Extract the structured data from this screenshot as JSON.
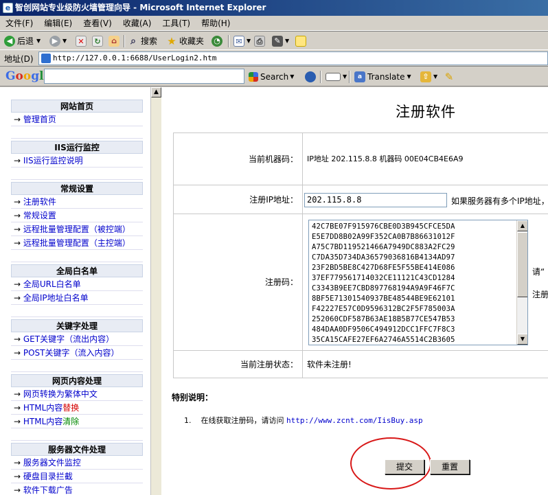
{
  "window": {
    "title": "智创网站专业级防火墙管理向导 - Microsoft Internet Explorer"
  },
  "menu": [
    "文件(F)",
    "编辑(E)",
    "查看(V)",
    "收藏(A)",
    "工具(T)",
    "帮助(H)"
  ],
  "toolbar": {
    "back": "后退",
    "search": "搜索",
    "favorites": "收藏夹"
  },
  "address": {
    "label": "地址(D)",
    "url": "http://127.0.0.1:6688/UserLogin2.htm"
  },
  "google": {
    "logo": "Google",
    "search": "Search",
    "translate": "Translate"
  },
  "nav": [
    {
      "title": "网站首页",
      "items": [
        {
          "text": "管理首页"
        }
      ]
    },
    {
      "title": "IIS运行监控",
      "items": [
        {
          "text": "IIS运行监控说明"
        }
      ]
    },
    {
      "title": "常规设置",
      "items": [
        {
          "text": "注册软件"
        },
        {
          "text": "常规设置"
        },
        {
          "text": "远程批量管理配置（被控端）"
        },
        {
          "text": "远程批量管理配置（主控端）"
        }
      ]
    },
    {
      "title": "全局白名单",
      "items": [
        {
          "text": "全局URL白名单"
        },
        {
          "text": "全局IP地址白名单"
        }
      ]
    },
    {
      "title": "关键字处理",
      "items": [
        {
          "text": "GET关键字（流出内容）"
        },
        {
          "text": "POST关键字（流入内容）"
        }
      ]
    },
    {
      "title": "网页内容处理",
      "items": [
        {
          "text": "网页转换为繁体中文"
        },
        {
          "text": "HTML内容替换"
        },
        {
          "text": "HTML内容清除"
        }
      ]
    },
    {
      "title": "服务器文件处理",
      "items": [
        {
          "text": "服务器文件监控"
        },
        {
          "text": "硬盘目录拦截"
        },
        {
          "text": "软件下载广告"
        }
      ]
    }
  ],
  "main": {
    "title": "注册软件",
    "machine_label": "当前机器码：",
    "machine_value": "IP地址 202.115.8.8 机器码 00E04CB4E6A9",
    "ip_label": "注册IP地址：",
    "ip_value": "202.115.8.8",
    "ip_hint": "如果服务器有多个IP地址，",
    "code_label": "注册码：",
    "code_lines": [
      "42C7BE07F915976CBE0D3B945CFCE5DA",
      "E5E7DD8B02A99F352CA0B7B86631012F",
      "A75C7BD119521466A7949DC883A2FC29",
      "C7DA35D734DA36579036816B4134AD97",
      "23F2BD5BE8C427D68FE5F55BE414E086",
      "37EF779561714032CE11121C43CD1284",
      "C3343B9EE7CBD897768194A9A9F46F7C",
      "8BF5E71301540937BE48544BE9E62101",
      "F42227E57C0D9596312BC2F5F785003A",
      "252060CDF587B63AE18B5B77CE547B53",
      "484DAA0DF9506C494912DCC1FFC7F8C3",
      "35CA15CAFE27EF6A2746A5514C2B3605"
    ],
    "code_hint_1": "请“",
    "code_hint_2": "注册",
    "status_label": "当前注册状态：",
    "status_value": "软件未注册!",
    "note_title": "特别说明：",
    "note_num": "1.",
    "note_text": "在线获取注册码，请访问",
    "note_url": "http://www.zcnt.com/IisBuy.asp",
    "submit": "提交",
    "reset": "重置"
  }
}
